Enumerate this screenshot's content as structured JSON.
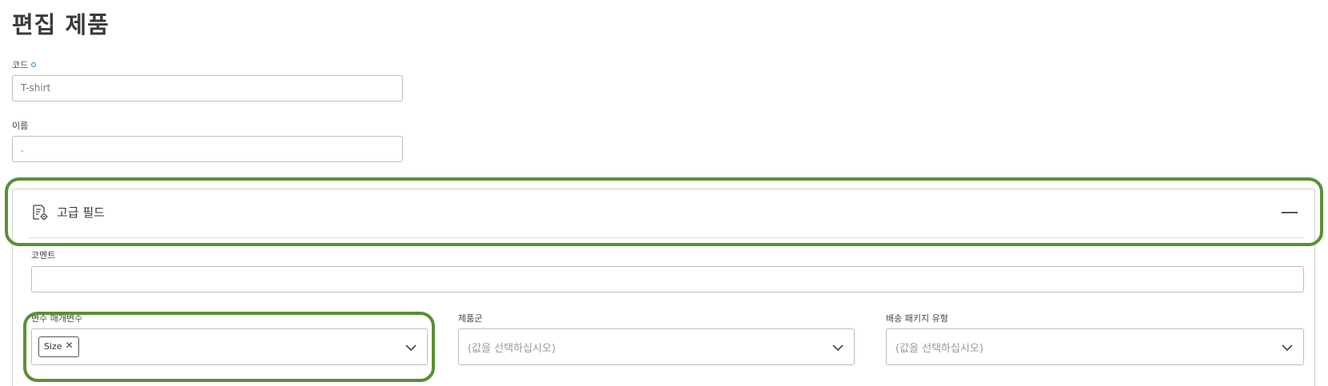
{
  "page": {
    "title": "편집 제품"
  },
  "form": {
    "code": {
      "label": "코드",
      "value": "T-shirt"
    },
    "name": {
      "label": "이름",
      "value": "."
    },
    "advanced": {
      "title": "고급 필드",
      "comment": {
        "label": "코멘트",
        "value": ""
      },
      "variant_params": {
        "label": "변수 매개변수",
        "tags": [
          "Size"
        ]
      },
      "product_group": {
        "label": "제품군",
        "placeholder": "(값을 선택하십시오)"
      },
      "package_type": {
        "label": "배송 패키지 유형",
        "placeholder": "(값을 선택하십시오)"
      }
    }
  },
  "colors": {
    "highlight": "#5a8f35",
    "required_dot": "#1e88c8"
  },
  "icons": {
    "advanced": "settings-document-icon",
    "collapse": "minus-icon",
    "dropdown": "chevron-down-icon",
    "remove_tag": "close-icon"
  }
}
